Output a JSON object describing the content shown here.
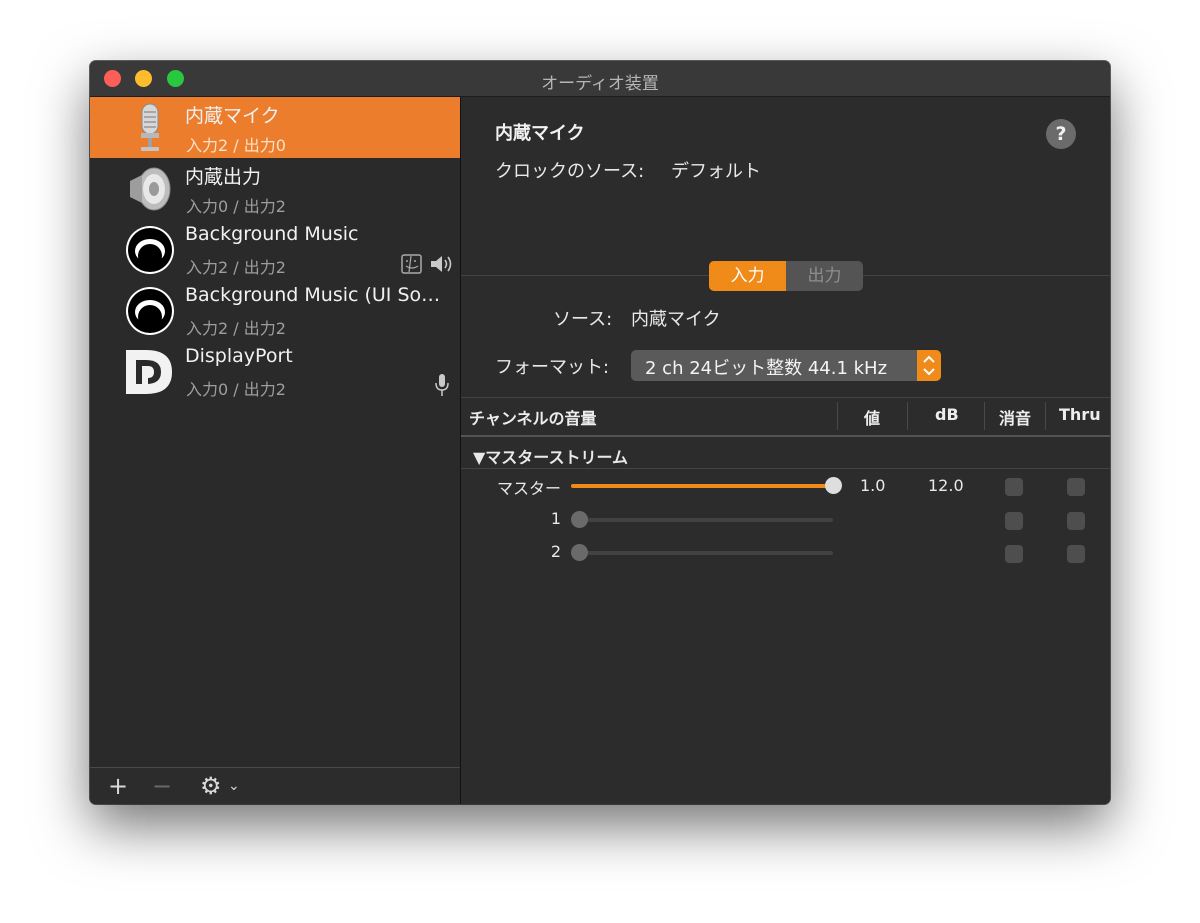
{
  "window": {
    "title": "オーディオ装置"
  },
  "sidebar": {
    "devices": [
      {
        "name": "内蔵マイク",
        "io": "入力2 / 出力0",
        "icon": "microphone-icon"
      },
      {
        "name": "内蔵出力",
        "io": "入力0 / 出力2",
        "icon": "speaker-icon"
      },
      {
        "name": "Background Music",
        "io": "入力2 / 出力2",
        "icon": "background-music-icon"
      },
      {
        "name": "Background Music (UI Sounds)",
        "io": "入力2 / 出力2",
        "icon": "background-music-icon"
      },
      {
        "name": "DisplayPort",
        "io": "入力0 / 出力2",
        "icon": "displayport-icon"
      }
    ],
    "toolbar": {
      "add_label": "+",
      "remove_label": "−",
      "gear_label": "⚙"
    }
  },
  "main": {
    "title": "内蔵マイク",
    "help_label": "?",
    "clock_label": "クロックのソース:",
    "clock_value": "デフォルト",
    "tabs": [
      {
        "label": "入力",
        "active": true
      },
      {
        "label": "出力",
        "active": false
      }
    ],
    "source_label": "ソース:",
    "source_value": "内蔵マイク",
    "format_label": "フォーマット:",
    "format_value": "2 ch 24ビット整数 44.1 kHz"
  },
  "table": {
    "headers": [
      "チャンネルの音量",
      "値",
      "dB",
      "消音",
      "Thru"
    ],
    "group": "▼マスターストリーム",
    "rows": [
      {
        "label": "マスター",
        "level": 1.0,
        "value": "1.0",
        "db": "12.0",
        "enabled": true
      },
      {
        "label": "1",
        "level": 0.0,
        "value": "",
        "db": "",
        "enabled": false
      },
      {
        "label": "2",
        "level": 0.0,
        "value": "",
        "db": "",
        "enabled": false
      }
    ]
  },
  "colors": {
    "accent": "#f08a18",
    "selection": "#ec7d2d"
  }
}
